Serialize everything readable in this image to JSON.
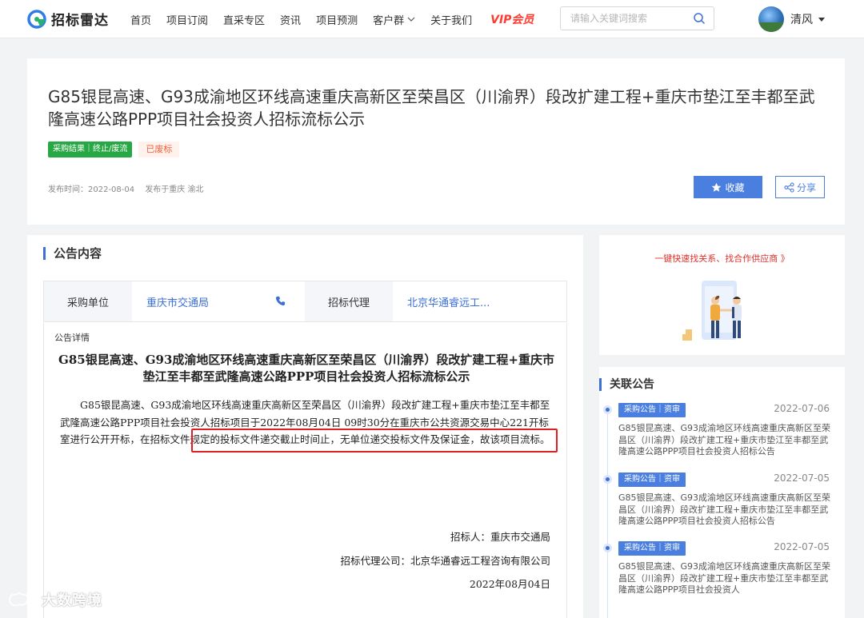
{
  "header": {
    "logo_text": "招标雷达",
    "nav": [
      "首页",
      "项目订阅",
      "直采专区",
      "资讯",
      "项目预测",
      "客户群",
      "关于我们"
    ],
    "vip_label": "VIP会员",
    "search_placeholder": "请输入关键词搜索",
    "user_name": "清风"
  },
  "notice": {
    "title": "G85银昆高速、G93成渝地区环线高速重庆高新区至荣昌区（川渝界）段改扩建工程+重庆市垫江至丰都至武隆高速公路PPP项目社会投资人招标流标公示",
    "tag_type": "采购结果｜终止/废流",
    "tag_status": "已废标",
    "publish_time": "发布时间：2022-08-04",
    "publish_region": "发布于重庆 渝北",
    "favorite_label": "收藏",
    "share_label": "分享"
  },
  "content": {
    "section_title": "公告内容",
    "buyer_label": "采购单位",
    "buyer_value": "重庆市交通局",
    "agent_label": "招标代理",
    "agent_value": "北京华通睿远工...",
    "detail_label": "公告详情",
    "doc_title": "G85银昆高速、G93成渝地区环线高速重庆高新区至荣昌区（川渝界）段改扩建工程+重庆市垫江至丰都至武隆高速公路PPP项目社会投资人招标流标公示",
    "doc_body": "G85银昆高速、G93成渝地区环线高速重庆高新区至荣昌区（川渝界）段改扩建工程+重庆市垫江至丰都至武隆高速公路PPP项目社会投资人招标项目于2022年08月04日 09时30分在重庆市公共资源交易中心221开标室进行公开开标，在招标文件规定的投标文件递交截止时间止，无单位递交投标文件及保证金，故该项目流标。",
    "sign_tenderer": "招标人：重庆市交通局",
    "sign_agent": "招标代理公司：北京华通睿远工程咨询有限公司",
    "sign_date": "2022年08月04日"
  },
  "sidebar": {
    "ad_link": "一键快速找关系、找合作供应商 》",
    "related_title": "关联公告",
    "related": [
      {
        "tag": "采购公告｜资审",
        "date": "2022-07-06",
        "text": "G85银昆高速、G93成渝地区环线高速重庆高新区至荣昌区（川渝界）段改扩建工程+重庆市垫江至丰都至武隆高速公路PPP项目社会投资人招标公告"
      },
      {
        "tag": "采购公告｜资审",
        "date": "2022-07-05",
        "text": "G85银昆高速、G93成渝地区环线高速重庆高新区至荣昌区（川渝界）段改扩建工程+重庆市垫江至丰都至武隆高速公路PPP项目社会投资人招标公告"
      },
      {
        "tag": "采购公告｜资审",
        "date": "2022-07-05",
        "text": "G85银昆高速、G93成渝地区环线高速重庆高新区至荣昌区（川渝界）段改扩建工程+重庆市垫江至丰都至武隆高速公路PPP项目社会投资人"
      }
    ]
  },
  "watermark_text": "大数跨境",
  "colors": {
    "accent": "#3d6fd6",
    "button": "#4a7fe0",
    "vip": "#ff3b30",
    "tag_green": "#28a745",
    "highlight": "#e02020"
  }
}
